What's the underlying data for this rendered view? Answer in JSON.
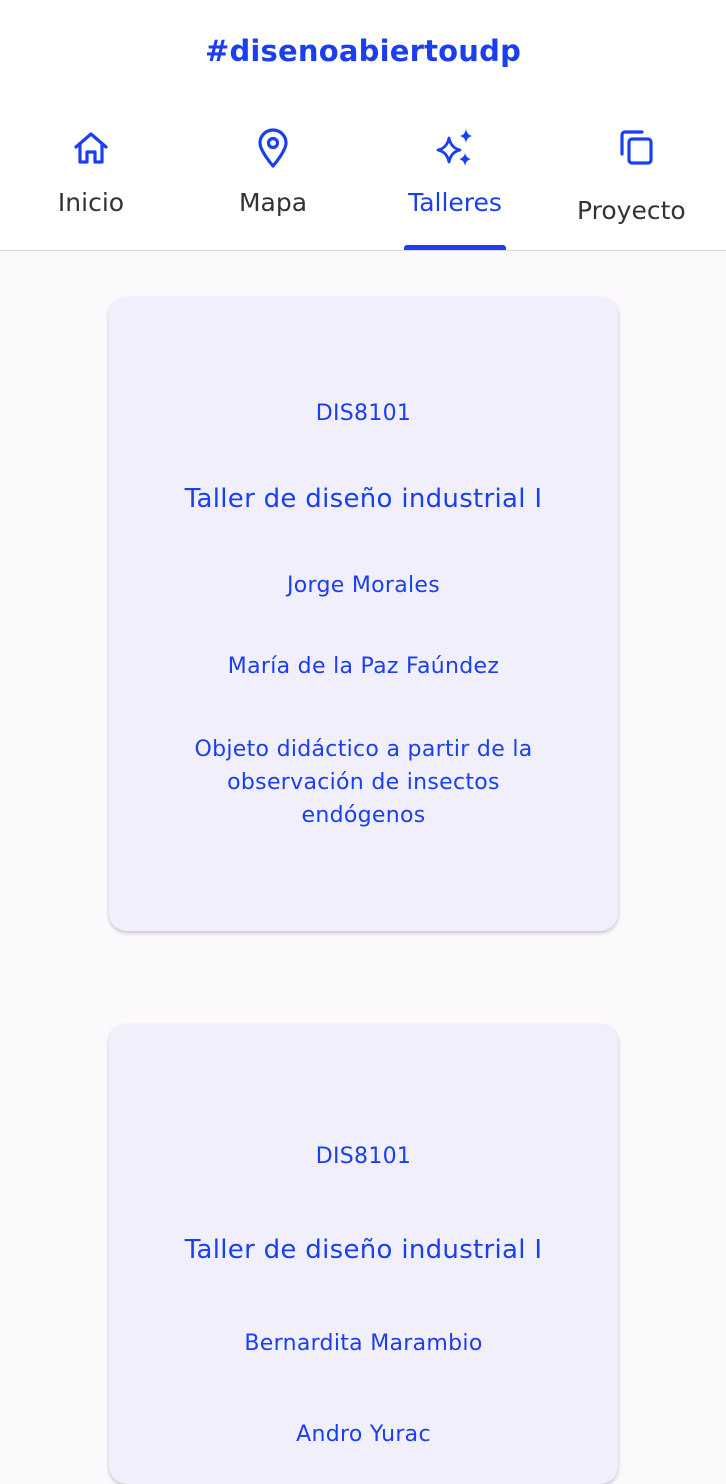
{
  "app": {
    "title": "#disenoabiertoudp",
    "accent_color": "#1a3ff0"
  },
  "tabs": [
    {
      "label": "Inicio",
      "icon": "home-icon",
      "active": false
    },
    {
      "label": "Mapa",
      "icon": "map-pin-icon",
      "active": false
    },
    {
      "label": "Talleres",
      "icon": "sparkles-icon",
      "active": true
    },
    {
      "label": "Proyecto",
      "icon": "copy-icon",
      "active": false
    }
  ],
  "cards": [
    {
      "code": "DIS8101",
      "title": "Taller de diseño industrial I",
      "teacher_1": "Jorge Morales",
      "teacher_2": "María de la Paz Faúndez",
      "description_line_1": "Objeto didáctico a partir de la",
      "description_line_2": "observación de insectos",
      "description_line_3": "endógenos"
    },
    {
      "code": "DIS8101",
      "title": "Taller de diseño industrial I",
      "teacher_1": "Bernardita Marambio",
      "teacher_2": "Andro Yurac"
    }
  ]
}
